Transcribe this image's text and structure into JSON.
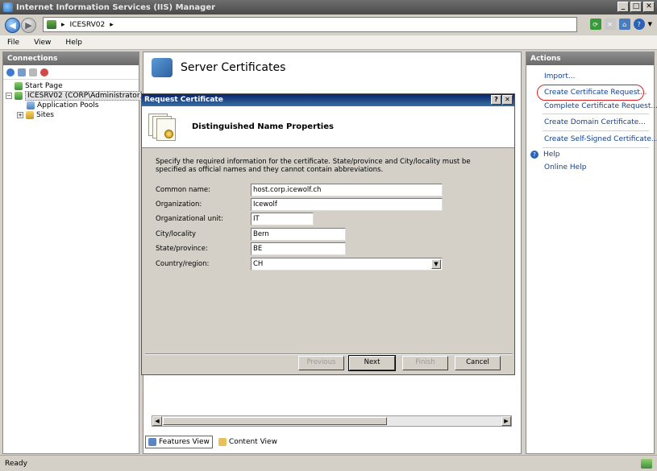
{
  "window": {
    "title": "Internet Information Services (IIS) Manager"
  },
  "address": {
    "crumb": "ICESRV02"
  },
  "menu": {
    "items": [
      "File",
      "View",
      "Help"
    ]
  },
  "connections": {
    "header": "Connections",
    "tree": {
      "start_page": "Start Page",
      "server": "ICESRV02 (CORP\\Administrator)",
      "app_pools": "Application Pools",
      "sites": "Sites"
    }
  },
  "main": {
    "title": "Server Certificates",
    "view_tabs": {
      "features": "Features View",
      "content": "Content View"
    }
  },
  "actions": {
    "header": "Actions",
    "items": {
      "import": "Import...",
      "create_request": "Create Certificate Request...",
      "complete_request": "Complete Certificate Request...",
      "create_domain": "Create Domain Certificate...",
      "create_self_signed": "Create Self-Signed Certificate...",
      "help": "Help",
      "online_help": "Online Help"
    }
  },
  "status": {
    "text": "Ready"
  },
  "dialog": {
    "title": "Request Certificate",
    "header": "Distinguished Name Properties",
    "description": "Specify the required information for the certificate. State/province and City/locality must be specified as official names and they cannot contain abbreviations.",
    "fields": {
      "common_name": {
        "label": "Common name:",
        "value": "host.corp.icewolf.ch"
      },
      "organization": {
        "label": "Organization:",
        "value": "Icewolf"
      },
      "org_unit": {
        "label": "Organizational unit:",
        "value": "IT"
      },
      "city": {
        "label": "City/locality",
        "value": "Bern"
      },
      "state": {
        "label": "State/province:",
        "value": "BE"
      },
      "country": {
        "label": "Country/region:",
        "value": "CH"
      }
    },
    "buttons": {
      "previous": "Previous",
      "next": "Next",
      "finish": "Finish",
      "cancel": "Cancel"
    }
  }
}
